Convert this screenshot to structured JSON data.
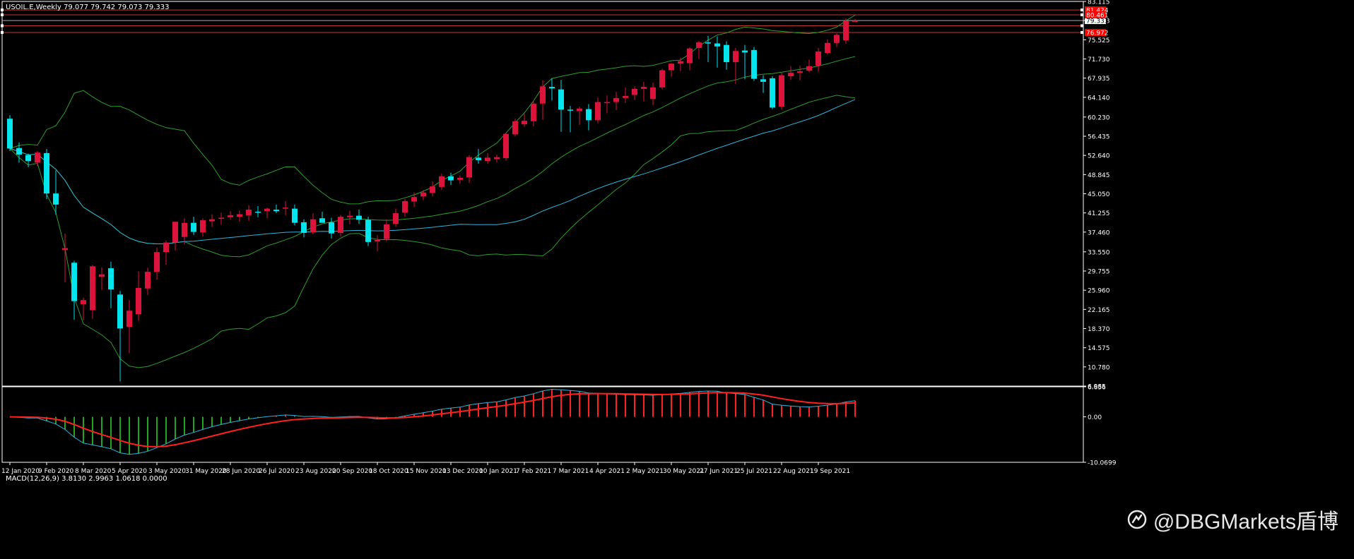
{
  "window": {
    "symbol_header": "USOIL.E,Weekly  79.077 79.742 79.073 79.333"
  },
  "macd": {
    "header": "MACD(12,26,9) 3.8130 2.9963 1.0618 0.0000"
  },
  "watermark": {
    "text": "@DBGMarkets盾博",
    "logo_icon": "weibo-icon"
  },
  "colors": {
    "background": "#000000",
    "bull": "#dc143c",
    "bear": "#00e5ee",
    "bands": "#2e9c2e",
    "ma": "#2fb4d9",
    "macd_signal": "#ff2020",
    "level_line": "#c0392b",
    "frame": "#ffffff"
  },
  "chart_data": [
    {
      "type": "candlestick",
      "title": "USOIL.E,Weekly",
      "x_ticks": [
        "12 Jan 2020",
        "9 Feb 2020",
        "8 Mar 2020",
        "5 Apr 2020",
        "3 May 2020",
        "31 May 2020",
        "28 Jun 2020",
        "26 Jul 2020",
        "23 Aug 2020",
        "20 Sep 2020",
        "18 Oct 2020",
        "15 Nov 2020",
        "13 Dec 2020",
        "10 Jan 2021",
        "7 Feb 2021",
        "7 Mar 2021",
        "4 Apr 2021",
        "2 May 2021",
        "30 May 2021",
        "27 Jun 2021",
        "25 Jul 2021",
        "22 Aug 2021",
        "19 Sep 2021"
      ],
      "y_ticks": [
        "83.115",
        "79.333",
        "75.525",
        "71.730",
        "67.935",
        "64.140",
        "60.230",
        "56.435",
        "52.640",
        "48.845",
        "45.050",
        "41.255",
        "37.460",
        "33.550",
        "29.755",
        "25.960",
        "22.165",
        "18.370",
        "14.575",
        "10.780",
        "6.985"
      ],
      "ylim": [
        6.985,
        83.115
      ],
      "current_price": "79.333",
      "levels": [
        {
          "value": 81.424,
          "label": "81.424"
        },
        {
          "value": 80.461,
          "label": "80.461"
        },
        {
          "value": 78.3,
          "label": ""
        },
        {
          "value": 76.972,
          "label": "76.972"
        }
      ],
      "ohlc": [
        [
          59.9,
          60.6,
          53.5,
          54.0
        ],
        [
          54.1,
          55.2,
          51.2,
          52.8
        ],
        [
          52.7,
          53.0,
          50.3,
          51.5
        ],
        [
          51.2,
          53.5,
          50.5,
          53.2
        ],
        [
          53.1,
          53.9,
          44.0,
          45.1
        ],
        [
          45.1,
          49.7,
          40.9,
          42.9
        ],
        [
          33.9,
          37.2,
          27.5,
          34.3
        ],
        [
          31.4,
          31.8,
          20.1,
          23.8
        ],
        [
          23.2,
          24.5,
          20.0,
          24.0
        ],
        [
          22.0,
          31.0,
          20.3,
          30.7
        ],
        [
          28.6,
          30.5,
          26.0,
          29.1
        ],
        [
          30.3,
          31.6,
          22.4,
          26.1
        ],
        [
          25.1,
          25.8,
          7.9,
          18.4
        ],
        [
          18.7,
          24.0,
          13.5,
          21.9
        ],
        [
          21.2,
          29.7,
          19.9,
          26.4
        ],
        [
          26.3,
          30.4,
          25.0,
          29.6
        ],
        [
          29.6,
          34.4,
          28.0,
          33.5
        ],
        [
          33.5,
          35.8,
          31.0,
          35.4
        ],
        [
          35.4,
          37.9,
          33.8,
          39.5
        ],
        [
          36.5,
          40.2,
          35.0,
          39.3
        ],
        [
          39.3,
          40.5,
          36.9,
          37.5
        ],
        [
          37.4,
          40.2,
          36.6,
          39.8
        ],
        [
          39.6,
          41.0,
          38.5,
          40.0
        ],
        [
          40.2,
          41.3,
          38.9,
          40.3
        ],
        [
          40.4,
          41.6,
          39.9,
          40.8
        ],
        [
          40.5,
          41.7,
          39.5,
          41.0
        ],
        [
          40.8,
          42.8,
          39.7,
          41.9
        ],
        [
          41.5,
          42.6,
          40.4,
          41.4
        ],
        [
          41.6,
          42.3,
          40.2,
          42.1
        ],
        [
          41.9,
          42.9,
          41.2,
          41.6
        ],
        [
          42.2,
          43.6,
          40.8,
          42.3
        ],
        [
          42.1,
          42.9,
          38.8,
          39.3
        ],
        [
          39.4,
          40.0,
          36.4,
          37.3
        ],
        [
          37.4,
          41.2,
          37.0,
          40.0
        ],
        [
          40.2,
          41.5,
          39.5,
          39.3
        ],
        [
          39.4,
          40.3,
          36.2,
          37.2
        ],
        [
          37.3,
          40.9,
          36.6,
          40.5
        ],
        [
          40.4,
          41.7,
          39.0,
          40.7
        ],
        [
          40.7,
          41.9,
          39.1,
          39.9
        ],
        [
          39.9,
          40.5,
          34.7,
          35.5
        ],
        [
          35.6,
          36.9,
          33.7,
          35.9
        ],
        [
          36.1,
          40.0,
          35.6,
          39.0
        ],
        [
          39.1,
          42.1,
          38.5,
          41.2
        ],
        [
          41.3,
          44.0,
          40.5,
          43.6
        ],
        [
          43.5,
          45.3,
          42.4,
          44.4
        ],
        [
          44.5,
          45.8,
          43.8,
          45.3
        ],
        [
          45.2,
          47.5,
          44.5,
          46.5
        ],
        [
          46.4,
          49.0,
          45.8,
          48.5
        ],
        [
          48.5,
          49.2,
          46.8,
          47.7
        ],
        [
          47.8,
          48.7,
          47.0,
          48.2
        ],
        [
          48.3,
          52.7,
          47.2,
          52.3
        ],
        [
          52.2,
          53.9,
          51.0,
          51.7
        ],
        [
          51.5,
          53.1,
          51.0,
          52.2
        ],
        [
          51.9,
          52.8,
          51.2,
          52.3
        ],
        [
          52.1,
          57.1,
          51.6,
          56.9
        ],
        [
          56.8,
          59.9,
          56.4,
          59.4
        ],
        [
          58.8,
          60.9,
          58.3,
          59.5
        ],
        [
          59.4,
          63.5,
          58.4,
          62.9
        ],
        [
          62.9,
          67.5,
          59.7,
          66.3
        ],
        [
          66.2,
          67.9,
          63.5,
          65.9
        ],
        [
          65.7,
          67.6,
          57.3,
          61.7
        ],
        [
          61.7,
          62.4,
          57.2,
          61.5
        ],
        [
          61.4,
          62.3,
          58.7,
          61.9
        ],
        [
          61.8,
          62.8,
          57.6,
          59.6
        ],
        [
          59.6,
          64.1,
          59.0,
          63.2
        ],
        [
          63.0,
          64.5,
          61.0,
          63.2
        ],
        [
          63.2,
          65.2,
          61.6,
          64.0
        ],
        [
          64.0,
          66.1,
          63.0,
          64.4
        ],
        [
          64.6,
          66.3,
          63.6,
          65.8
        ],
        [
          65.8,
          67.2,
          63.3,
          66.2
        ],
        [
          63.8,
          67.0,
          62.6,
          66.1
        ],
        [
          66.1,
          69.8,
          65.7,
          69.5
        ],
        [
          69.5,
          70.9,
          68.2,
          70.8
        ],
        [
          70.8,
          72.0,
          69.3,
          71.3
        ],
        [
          70.9,
          74.0,
          69.5,
          73.8
        ],
        [
          73.9,
          75.3,
          71.7,
          75.0
        ],
        [
          75.0,
          76.3,
          71.1,
          74.9
        ],
        [
          74.8,
          76.2,
          70.0,
          74.2
        ],
        [
          74.5,
          75.2,
          69.6,
          71.1
        ],
        [
          71.1,
          73.9,
          66.8,
          73.3
        ],
        [
          73.4,
          74.5,
          67.7,
          73.0
        ],
        [
          73.5,
          74.1,
          67.4,
          67.8
        ],
        [
          67.7,
          68.5,
          65.0,
          67.2
        ],
        [
          67.9,
          68.3,
          61.8,
          62.1
        ],
        [
          62.3,
          69.0,
          61.7,
          68.5
        ],
        [
          68.3,
          70.3,
          67.6,
          69.0
        ],
        [
          69.0,
          70.4,
          67.5,
          69.3
        ],
        [
          69.4,
          71.6,
          69.1,
          70.3
        ],
        [
          70.4,
          73.9,
          69.2,
          73.2
        ],
        [
          72.9,
          75.6,
          72.6,
          74.9
        ],
        [
          74.9,
          76.8,
          74.1,
          76.5
        ],
        [
          75.4,
          79.8,
          74.7,
          79.3
        ],
        [
          79.1,
          79.7,
          79.0,
          79.3
        ]
      ]
    },
    {
      "type": "macd",
      "title": "MACD(12,26,9)",
      "params": [
        12,
        26,
        9
      ],
      "values": {
        "macd": 3.813,
        "signal": 2.9963,
        "histogram": 1.0618,
        "extra": 0.0
      },
      "y_ticks": [
        "6.656",
        "0.00",
        "-10.0699"
      ],
      "ylim": [
        -10.0699,
        6.656
      ]
    }
  ]
}
